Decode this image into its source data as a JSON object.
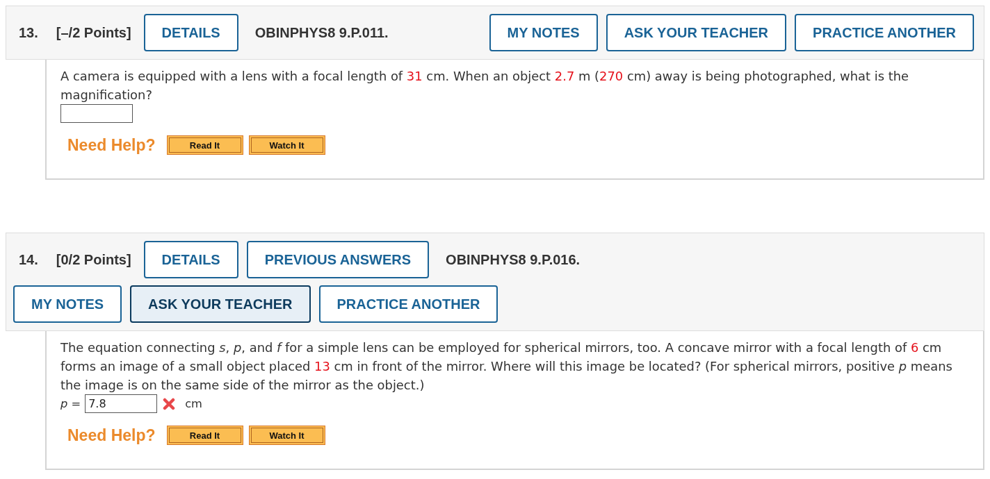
{
  "problems": [
    {
      "number": "13.",
      "points": "[–/2 Points]",
      "items": [
        {
          "kind": "button",
          "label": "DETAILS"
        },
        {
          "kind": "code",
          "label": "OBINPHYS8 9.P.011."
        }
      ],
      "actions": [
        {
          "label": "MY NOTES",
          "highlighted": false
        },
        {
          "label": "ASK YOUR TEACHER",
          "highlighted": false
        },
        {
          "label": "PRACTICE ANOTHER",
          "highlighted": false
        }
      ],
      "question": [
        {
          "kind": "text",
          "text": "A camera is equipped with a lens with a focal length of "
        },
        {
          "kind": "value",
          "text": "31"
        },
        {
          "kind": "text",
          "text": " cm. When an object "
        },
        {
          "kind": "value",
          "text": "2.7"
        },
        {
          "kind": "text",
          "text": " m ("
        },
        {
          "kind": "value",
          "text": "270"
        },
        {
          "kind": "text",
          "text": " cm) away is being photographed, what is the magnification?"
        }
      ],
      "answer": {
        "incorrect": false
      },
      "help": {
        "label": "Need Help?",
        "buttons": [
          "Read It",
          "Watch It"
        ]
      }
    },
    {
      "number": "14.",
      "points": "[0/2 Points]",
      "items": [
        {
          "kind": "button",
          "label": "DETAILS"
        },
        {
          "kind": "button",
          "label": "PREVIOUS ANSWERS"
        },
        {
          "kind": "code",
          "label": "OBINPHYS8 9.P.016."
        }
      ],
      "actions": [
        {
          "label": "MY NOTES",
          "highlighted": false
        },
        {
          "label": "ASK YOUR TEACHER",
          "highlighted": true
        },
        {
          "label": "PRACTICE ANOTHER",
          "highlighted": false
        }
      ],
      "question": [
        {
          "kind": "text",
          "text": "The equation connecting "
        },
        {
          "kind": "var",
          "text": "s"
        },
        {
          "kind": "text",
          "text": ", "
        },
        {
          "kind": "var",
          "text": "p"
        },
        {
          "kind": "text",
          "text": ", and "
        },
        {
          "kind": "var",
          "text": "f"
        },
        {
          "kind": "text",
          "text": " for a simple lens can be employed for spherical mirrors, too. A concave mirror with a focal length of "
        },
        {
          "kind": "value",
          "text": "6"
        },
        {
          "kind": "text",
          "text": " cm forms an image of a small object placed "
        },
        {
          "kind": "value",
          "text": "13"
        },
        {
          "kind": "text",
          "text": " cm in front of the mirror. Where will this image be located? (For spherical mirrors, positive "
        },
        {
          "kind": "var",
          "text": "p"
        },
        {
          "kind": "text",
          "text": " means the image is on the same side of the mirror as the object.)"
        }
      ],
      "answer": {
        "prefix": "*p* =",
        "value": "7.8",
        "incorrect": true,
        "unit": "cm"
      },
      "help": {
        "label": "Need Help?",
        "buttons": [
          "Read It",
          "Watch It"
        ]
      }
    }
  ]
}
